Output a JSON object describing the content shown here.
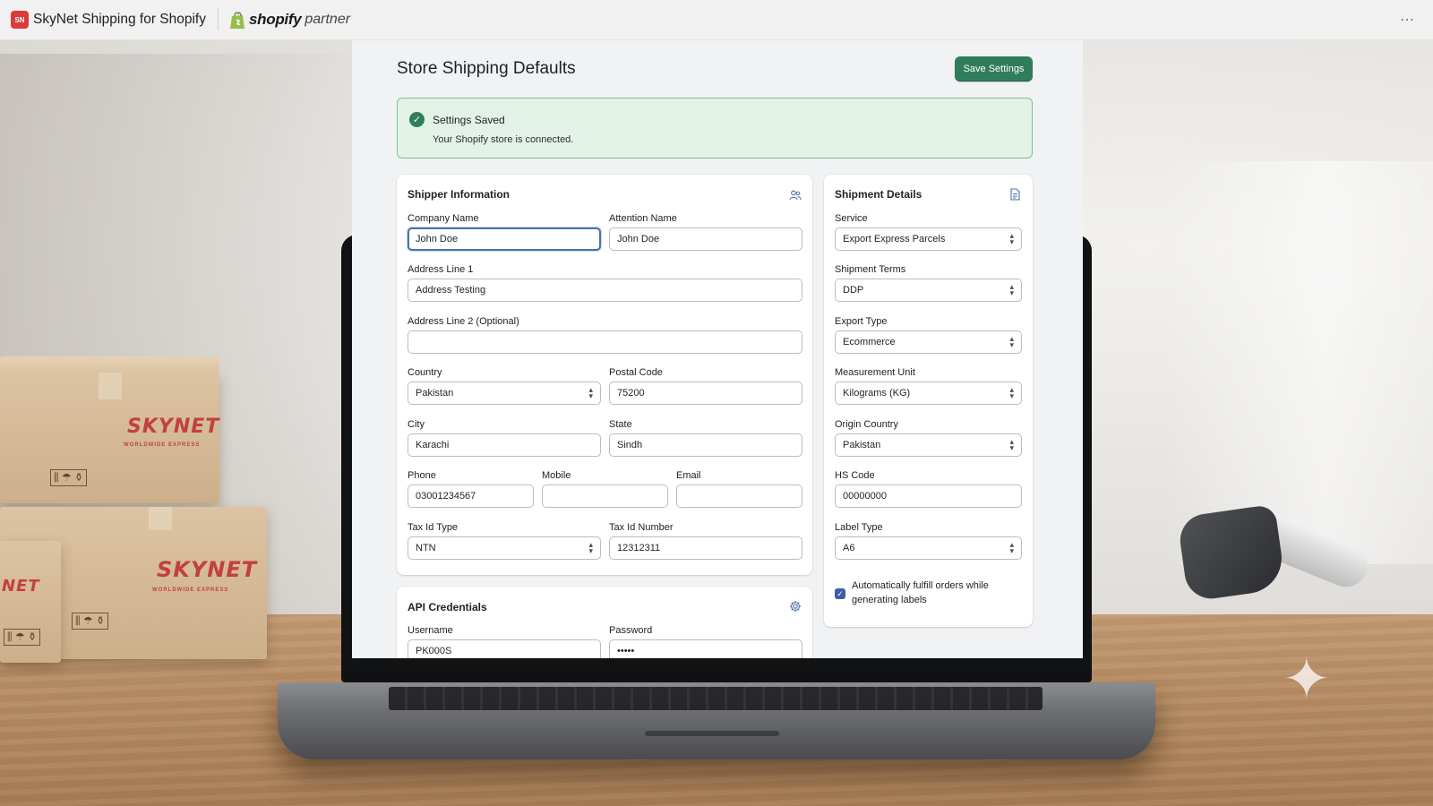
{
  "appbar": {
    "app_name": "SkyNet Shipping for Shopify",
    "app_icon_text": "SN",
    "shopify_word": "shopify",
    "partner_word": "partner",
    "more_icon": "⋯"
  },
  "scene": {
    "box_brand": "SKYNET",
    "box_brand_partial": "NET",
    "box_sub": "WORLDWIDE EXPRESS",
    "box_icons": "⫼ ☂ ⚱"
  },
  "page": {
    "title": "Store Shipping Defaults",
    "save_label": "Save Settings"
  },
  "banner": {
    "title": "Settings Saved",
    "text": "Your Shopify store is connected."
  },
  "shipper": {
    "title": "Shipper Information",
    "company_label": "Company Name",
    "company_value": "John Doe",
    "attention_label": "Attention Name",
    "attention_value": "John Doe",
    "address1_label": "Address Line 1",
    "address1_value": "Address Testing",
    "address2_label": "Address Line 2 (Optional)",
    "address2_value": "",
    "country_label": "Country",
    "country_value": "Pakistan",
    "postal_label": "Postal Code",
    "postal_value": "75200",
    "city_label": "City",
    "city_value": "Karachi",
    "state_label": "State",
    "state_value": "Sindh",
    "phone_label": "Phone",
    "phone_value": "03001234567",
    "mobile_label": "Mobile",
    "mobile_value": "",
    "email_label": "Email",
    "email_value": "",
    "taxtype_label": "Tax Id Type",
    "taxtype_value": "NTN",
    "taxnum_label": "Tax Id Number",
    "taxnum_value": "12312311"
  },
  "api": {
    "title": "API Credentials",
    "username_label": "Username",
    "username_value": "PK000S",
    "password_label": "Password",
    "password_value": "•••••"
  },
  "shipment": {
    "title": "Shipment Details",
    "service_label": "Service",
    "service_value": "Export Express Parcels",
    "terms_label": "Shipment Terms",
    "terms_value": "DDP",
    "export_label": "Export Type",
    "export_value": "Ecommerce",
    "unit_label": "Measurement Unit",
    "unit_value": "Kilograms (KG)",
    "origin_label": "Origin Country",
    "origin_value": "Pakistan",
    "hs_label": "HS Code",
    "hs_value": "00000000",
    "labeltype_label": "Label Type",
    "labeltype_value": "A6",
    "autofulfill_label": "Automatically fulfill orders while generating labels",
    "autofulfill_checked": true
  },
  "colors": {
    "primary_button": "#2f7d5b",
    "success_banner": "#e3f2e7",
    "focus_ring": "#4f6fa8",
    "brand_red": "#d93b3b"
  }
}
